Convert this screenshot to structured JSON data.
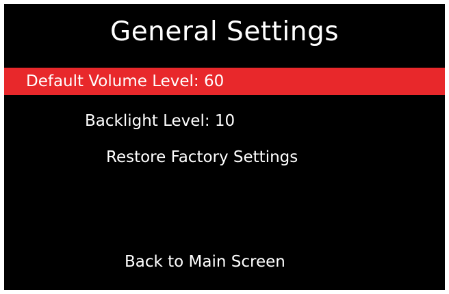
{
  "screen": {
    "title": "General Settings",
    "background_color": "#000000",
    "highlight_color": "#e8282b",
    "text_color": "#ffffff"
  },
  "menu": {
    "selected_index": 0,
    "items": [
      {
        "label": "Default Volume Level: 60"
      },
      {
        "label": "Backlight Level: 10"
      },
      {
        "label": "Restore Factory Settings"
      },
      {
        "label": "Back to Main Screen"
      }
    ]
  }
}
